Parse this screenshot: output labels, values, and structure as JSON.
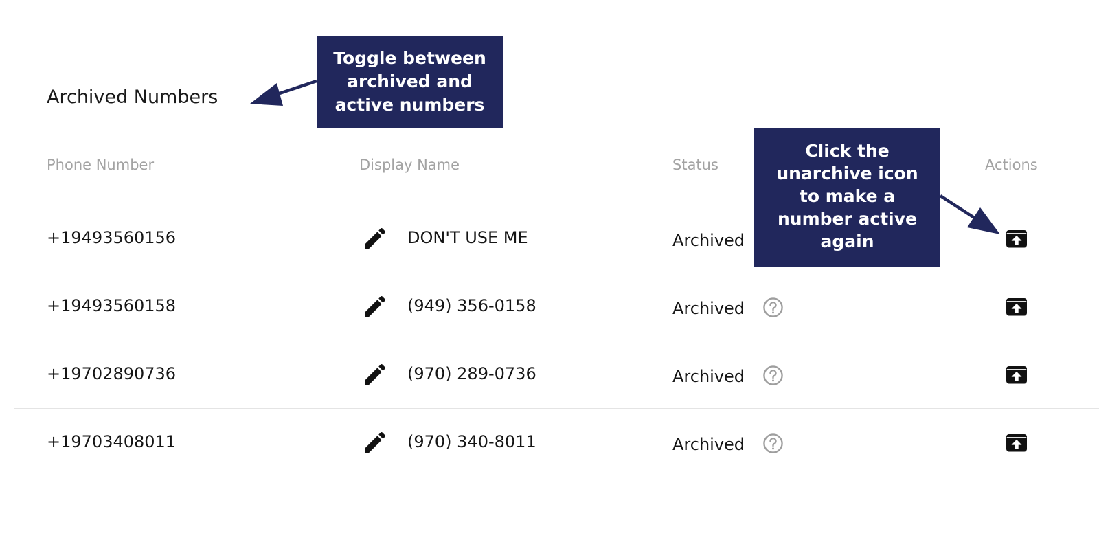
{
  "toggle": {
    "label": "Archived Numbers"
  },
  "table": {
    "columns": {
      "phone": "Phone Number",
      "display_name": "Display Name",
      "status": "Status",
      "actions": "Actions"
    },
    "rows": [
      {
        "phone": "+19493560156",
        "display_name": "DON'T USE ME",
        "status": "Archived"
      },
      {
        "phone": "+19493560158",
        "display_name": "(949) 356-0158",
        "status": "Archived"
      },
      {
        "phone": "+19702890736",
        "display_name": "(970) 289-0736",
        "status": "Archived"
      },
      {
        "phone": "+19703408011",
        "display_name": "(970) 340-8011",
        "status": "Archived"
      }
    ]
  },
  "callouts": {
    "toggle_hint": {
      "lines": [
        "Toggle between",
        "archived and",
        "active numbers"
      ]
    },
    "unarchive_hint": {
      "lines": [
        "Click the",
        "unarchive icon",
        "to make a",
        "number active",
        "again"
      ]
    }
  },
  "icons": {
    "edit": "pencil-icon",
    "help": "question-circle-icon",
    "unarchive": "unarchive-icon"
  },
  "colors": {
    "callout_bg": "#21275c",
    "header_text": "#a3a3a3",
    "divider": "#e4e4e4"
  }
}
